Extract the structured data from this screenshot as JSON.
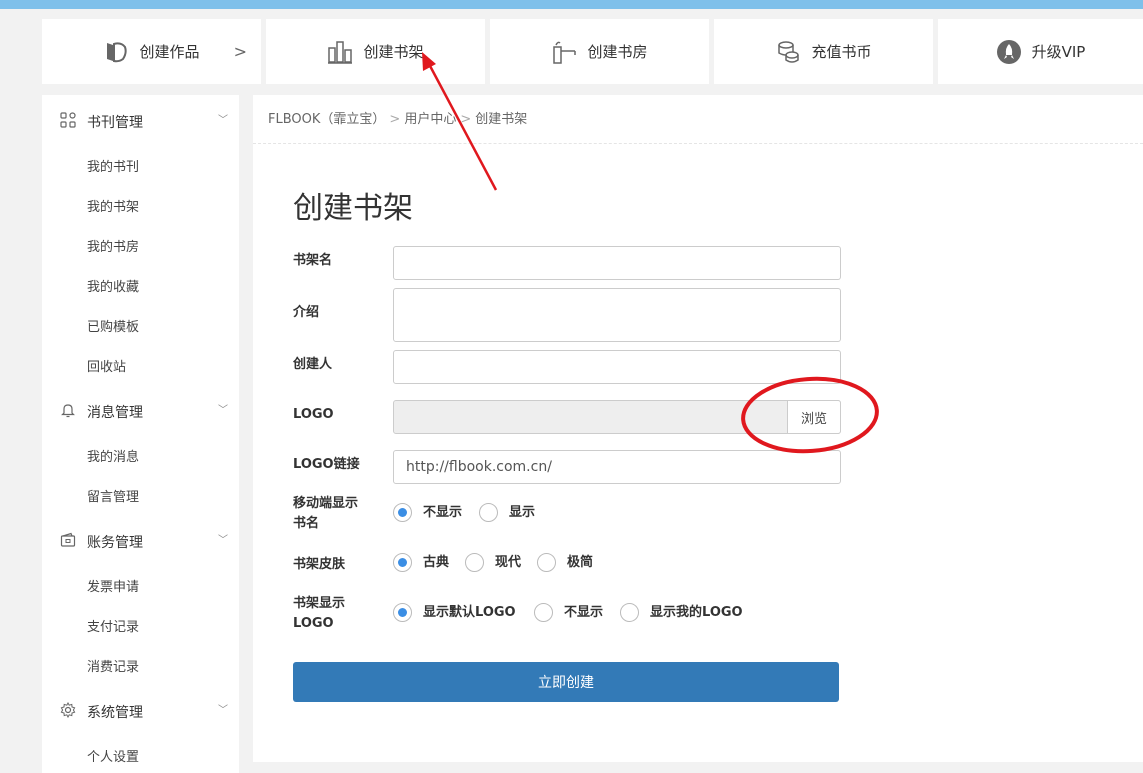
{
  "top_nav": [
    {
      "label": "创建作品",
      "icon": "books-icon"
    },
    {
      "label": "创建书架",
      "icon": "bookshelf-icon"
    },
    {
      "label": "创建书房",
      "icon": "book-room-icon"
    },
    {
      "label": "充值书币",
      "icon": "coins-icon"
    },
    {
      "label": "升级VIP",
      "icon": "rocket-icon"
    }
  ],
  "sidebar": {
    "sections": [
      {
        "label": "书刊管理",
        "icon": "grid-icon",
        "items": [
          "我的书刊",
          "我的书架",
          "我的书房",
          "我的收藏",
          "已购模板",
          "回收站"
        ]
      },
      {
        "label": "消息管理",
        "icon": "bell-icon",
        "items": [
          "我的消息",
          "留言管理"
        ]
      },
      {
        "label": "账务管理",
        "icon": "wallet-icon",
        "items": [
          "发票申请",
          "支付记录",
          "消费记录"
        ]
      },
      {
        "label": "系统管理",
        "icon": "gear-icon",
        "items": [
          "个人设置"
        ]
      }
    ]
  },
  "breadcrumb": [
    "FLBOOK（霏立宝）",
    "用户中心",
    "创建书架"
  ],
  "page_title": "创建书架",
  "form": {
    "name_label": "书架名",
    "intro_label": "介绍",
    "creator_label": "创建人",
    "logo_label": "LOGO",
    "browse_label": "浏览",
    "logo_link_label": "LOGO链接",
    "logo_link_value": "http://flbook.com.cn/",
    "mobile_show_label_line1": "移动端显示",
    "mobile_show_label_line2": "书名",
    "mobile_show_options": [
      "不显示",
      "显示"
    ],
    "mobile_show_selected": 0,
    "skin_label": "书架皮肤",
    "skin_options": [
      "古典",
      "现代",
      "极简"
    ],
    "skin_selected": 0,
    "logo_display_label_line1": "书架显示",
    "logo_display_label_line2": "LOGO",
    "logo_display_options": [
      "显示默认LOGO",
      "不显示",
      "显示我的LOGO"
    ],
    "logo_display_selected": 0,
    "submit_label": "立即创建"
  },
  "colors": {
    "primary": "#337ab7",
    "radio_selected": "#3b8ee4",
    "annotation": "#e0181e",
    "top_strip": "#7fc0ea"
  }
}
